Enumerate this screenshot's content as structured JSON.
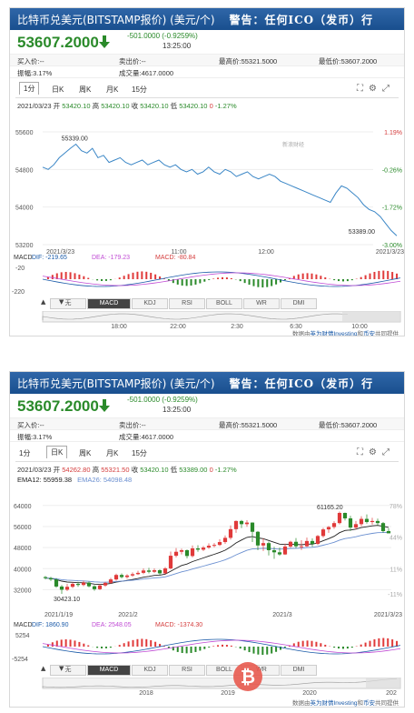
{
  "header": {
    "title": "比特币兑美元(BITSTAMP报价) (美元/个)",
    "warning": "警告：任何ICO（发币）行"
  },
  "quote": {
    "price": "53607.2000",
    "change": "-501.0000 (-0.9259%)",
    "time": "13:25:00"
  },
  "stats": {
    "buy": "买入价:--",
    "sell": "卖出价:--",
    "high": "最高价:55321.5000",
    "low": "最低价:53607.2000",
    "amplitude": "振幅:3.17%",
    "volume": "成交量:4617.0000"
  },
  "colors": {
    "up": "#e03a3a",
    "down": "#2a8a2a",
    "line": "#3a86c6",
    "header": "#1f57a0"
  },
  "panel1": {
    "tabs": [
      "1分",
      "日K",
      "周K",
      "月K",
      "15分"
    ],
    "active_tab": "1分",
    "ohlc": {
      "date": "2021/03/23",
      "open_label": "开",
      "open": "53420.10",
      "high_label": "高",
      "high": "53420.10",
      "close_label": "收",
      "close": "53420.10",
      "low_label": "低",
      "low": "53420.10",
      "chg": "0",
      "pct": "-1.27%"
    },
    "watermark": "新浪财经",
    "macd": {
      "label": "MACD",
      "dif": "DIF: -219.65",
      "dea": "DEA: -179.23",
      "macd": "MACD: -80.84",
      "y_top": "-20",
      "y_bottom": "-220"
    },
    "nav_times": [
      "18:00",
      "22:00",
      "2:30",
      "6:30",
      "10:00"
    ],
    "nav_play": "▲",
    "nav_down": "▼",
    "indicators": [
      "无",
      "MACD",
      "KDJ",
      "RSI",
      "BOLL",
      "WR",
      "DMI"
    ],
    "active_indicator": "MACD"
  },
  "panel2": {
    "tabs": [
      "1分",
      "日K",
      "周K",
      "月K",
      "15分"
    ],
    "active_tab": "日K",
    "ohlc": {
      "date": "2021/03/23",
      "open_label": "开",
      "open": "54262.80",
      "high_label": "高",
      "high": "55321.50",
      "close_label": "收",
      "close": "53420.10",
      "low_label": "低",
      "low": "53389.00",
      "chg": "0",
      "pct": "-1.27%"
    },
    "ema": {
      "ema12": "EMA12: 55959.38",
      "ema26": "EMA26: 54098.48"
    },
    "macd": {
      "label": "MACD",
      "dif": "DIF: 1860.90",
      "dea": "DEA: 2548.05",
      "macd": "MACD: -1374.30",
      "y_top": "5254",
      "y_bottom": "-5254"
    },
    "nav_years": [
      "2018",
      "2019",
      "2020",
      "202"
    ],
    "nav_play": "▲",
    "nav_down": "▼",
    "indicators": [
      "无",
      "MACD",
      "KDJ",
      "RSI",
      "BOLL",
      "WR",
      "DMI"
    ],
    "active_indicator": "MACD"
  },
  "footer": {
    "prefix": "数据由",
    "brand": "英为财情Investing",
    "mid": "和",
    "brand2": "币安",
    "suffix": "共同提供"
  },
  "chart_data": [
    {
      "type": "line",
      "title": "",
      "x_ticks": [
        "2021/3/23",
        "11:00",
        "12:00",
        "2021/3/23"
      ],
      "y_ticks": [
        55600,
        54800,
        54000,
        53200
      ],
      "pct_ticks": [
        "1.19%",
        "-0.26%",
        "-1.72%",
        "-3.00%"
      ],
      "ylim": [
        53200,
        55600
      ],
      "annotations": [
        {
          "text": "55339.00",
          "value": 55339
        },
        {
          "text": "53389.00",
          "value": 53389
        }
      ],
      "values": [
        54850,
        54800,
        54900,
        55050,
        55150,
        55250,
        55339,
        55200,
        55150,
        55250,
        55050,
        55100,
        54950,
        55000,
        55050,
        54950,
        54900,
        54950,
        55000,
        54900,
        54950,
        55000,
        54900,
        54850,
        54900,
        54800,
        54750,
        54800,
        54700,
        54750,
        54850,
        54750,
        54700,
        54800,
        54750,
        54650,
        54700,
        54750,
        54650,
        54600,
        54650,
        54700,
        54650,
        54550,
        54500,
        54450,
        54400,
        54350,
        54300,
        54250,
        54200,
        54150,
        54100,
        54300,
        54450,
        54400,
        54300,
        54200,
        54050,
        53950,
        53900,
        53800,
        53650,
        53500,
        53389
      ]
    },
    {
      "type": "candlestick",
      "title": "",
      "x_ticks": [
        "2021/1/19",
        "2021/2",
        "2021/3",
        "2021/3/23"
      ],
      "y_ticks": [
        64000,
        56000,
        48000,
        40000,
        32000
      ],
      "pct_ticks": [
        "78%",
        "44%",
        "11%",
        "-11%"
      ],
      "ylim": [
        28000,
        66000
      ],
      "annotations": [
        {
          "text": "61165.20",
          "value": 61165
        },
        {
          "text": "30423.10",
          "value": 30423
        }
      ],
      "candles": [
        [
          36800,
          36400,
          37200,
          35900
        ],
        [
          36400,
          35900,
          36900,
          35300
        ],
        [
          35900,
          33200,
          36400,
          32700
        ],
        [
          33200,
          32000,
          33800,
          30423
        ],
        [
          32000,
          33100,
          34200,
          31500
        ],
        [
          33100,
          34200,
          34800,
          32600
        ],
        [
          34200,
          33800,
          35000,
          33100
        ],
        [
          33800,
          34700,
          35400,
          33300
        ],
        [
          34700,
          33300,
          35100,
          32900
        ],
        [
          33300,
          32200,
          33700,
          31600
        ],
        [
          32200,
          33600,
          34200,
          31900
        ],
        [
          33600,
          34600,
          35000,
          33100
        ],
        [
          34600,
          35900,
          36500,
          34200
        ],
        [
          35900,
          37600,
          38100,
          35400
        ],
        [
          37600,
          36800,
          38200,
          36300
        ],
        [
          36800,
          37400,
          37900,
          36200
        ],
        [
          37400,
          37900,
          38600,
          36900
        ],
        [
          37900,
          38400,
          39200,
          37600
        ],
        [
          38400,
          39300,
          40100,
          37900
        ],
        [
          39300,
          38800,
          40300,
          38200
        ],
        [
          38800,
          39400,
          40100,
          38300
        ],
        [
          39400,
          38200,
          39800,
          37600
        ],
        [
          38200,
          40100,
          40600,
          37900
        ],
        [
          40100,
          44900,
          46500,
          39700
        ],
        [
          44900,
          46400,
          47800,
          44300
        ],
        [
          46400,
          47000,
          47600,
          45400
        ],
        [
          47000,
          44800,
          47300,
          43900
        ],
        [
          44800,
          47700,
          48800,
          44300
        ],
        [
          47700,
          47200,
          48900,
          46400
        ],
        [
          47200,
          48000,
          48600,
          46700
        ],
        [
          48000,
          48700,
          49600,
          47500
        ],
        [
          48700,
          49000,
          49700,
          48100
        ],
        [
          49000,
          50100,
          51200,
          48600
        ],
        [
          50100,
          51700,
          52600,
          49400
        ],
        [
          51700,
          55000,
          56400,
          51000
        ],
        [
          55000,
          58100,
          58300,
          53600
        ],
        [
          58100,
          56900,
          58500,
          55400
        ],
        [
          56900,
          57500,
          58400,
          55900
        ],
        [
          57500,
          54000,
          57600,
          50100
        ],
        [
          54000,
          48800,
          54300,
          47000
        ],
        [
          48800,
          49700,
          51500,
          46700
        ],
        [
          49700,
          47000,
          50300,
          45000
        ],
        [
          47000,
          46200,
          48300,
          43700
        ],
        [
          46200,
          45400,
          48000,
          44900
        ],
        [
          45400,
          48400,
          49500,
          45200
        ],
        [
          48400,
          50200,
          50600,
          47900
        ],
        [
          50200,
          48500,
          51600,
          47800
        ],
        [
          48500,
          48500,
          50800,
          47100
        ],
        [
          48500,
          50500,
          51800,
          48200
        ],
        [
          50500,
          49400,
          51500,
          48300
        ],
        [
          49400,
          52400,
          52800,
          49000
        ],
        [
          52400,
          54900,
          55500,
          51800
        ],
        [
          54900,
          55800,
          56200,
          53600
        ],
        [
          55800,
          57300,
          58000,
          55100
        ],
        [
          57300,
          61165,
          61700,
          56800
        ],
        [
          61165,
          59100,
          61300,
          58300
        ],
        [
          59100,
          55600,
          60100,
          54300
        ],
        [
          55600,
          56900,
          58100,
          54800
        ],
        [
          56900,
          58900,
          59900,
          56100
        ],
        [
          58900,
          57700,
          60600,
          57100
        ],
        [
          57700,
          58100,
          59300,
          56700
        ],
        [
          58100,
          57300,
          59000,
          56400
        ],
        [
          57300,
          54262,
          57700,
          53600
        ],
        [
          54262,
          53420,
          55321,
          53389
        ]
      ]
    }
  ]
}
